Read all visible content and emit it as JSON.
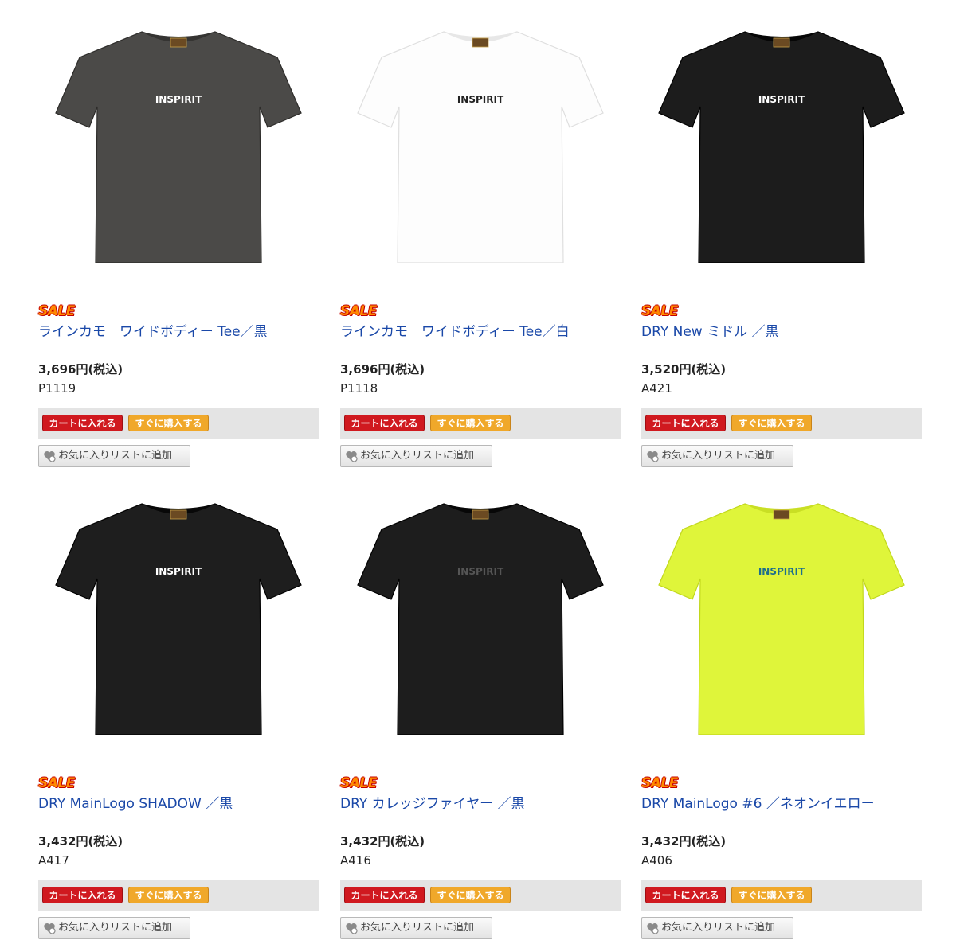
{
  "colors": {
    "link": "#1a48a8",
    "sale": "#ff8a00",
    "cart_button": "#d0191f",
    "buy_button": "#f0a82a",
    "button_bar": "#e4e4e4"
  },
  "buttons": {
    "cart": "カートに入れる",
    "buy_now": "すぐに購入する",
    "favorite": "お気に入りリストに追加"
  },
  "products": [
    {
      "badge": "SALE",
      "name": "ラインカモ　ワイドボディー Tee／黒",
      "price": "3,696円(税込)",
      "code": "P1119",
      "shirt_color": "#4b4a48",
      "print_color": "#ffffff",
      "logo": "INSPIRIT"
    },
    {
      "badge": "SALE",
      "name": "ラインカモ　ワイドボディー Tee／白",
      "price": "3,696円(税込)",
      "code": "P1118",
      "shirt_color": "#fdfdfd",
      "print_color": "#222222",
      "logo": "INSPIRIT"
    },
    {
      "badge": "SALE",
      "name": "DRY New ミドル ／黒",
      "price": "3,520円(税込)",
      "code": "A421",
      "shirt_color": "#1c1c1c",
      "print_color": "#ffffff",
      "logo": "INSPIRIT"
    },
    {
      "badge": "SALE",
      "name": "DRY MainLogo SHADOW ／黒",
      "price": "3,432円(税込)",
      "code": "A417",
      "shirt_color": "#1e1e1e",
      "print_color": "#ffffff",
      "logo": "INSPIRIT"
    },
    {
      "badge": "SALE",
      "name": "DRY カレッジファイヤー ／黒",
      "price": "3,432円(税込)",
      "code": "A416",
      "shirt_color": "#1d1d1d",
      "print_color": "#555555",
      "logo": "INSPIRIT"
    },
    {
      "badge": "SALE",
      "name": "DRY MainLogo #6 ／ネオンイエロー",
      "price": "3,432円(税込)",
      "code": "A406",
      "shirt_color": "#dff53a",
      "print_color": "#1e6f8c",
      "logo": "INSPIRIT"
    }
  ]
}
